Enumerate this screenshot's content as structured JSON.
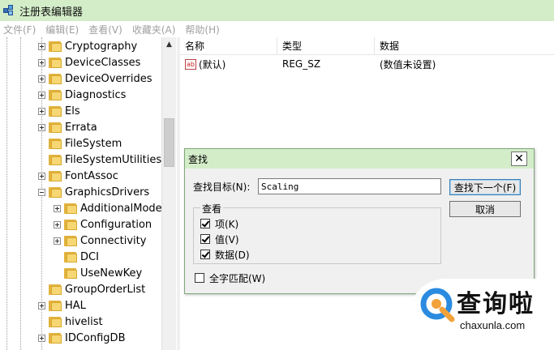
{
  "window": {
    "title": "注册表编辑器"
  },
  "menu": {
    "items": [
      "文件(F)",
      "编辑(E)",
      "查看(V)",
      "收藏夹(A)",
      "帮助(H)"
    ]
  },
  "tree": {
    "items": [
      {
        "label": "Cryptography",
        "expanded": false
      },
      {
        "label": "DeviceClasses",
        "expanded": false
      },
      {
        "label": "DeviceOverrides",
        "expanded": false
      },
      {
        "label": "Diagnostics",
        "expanded": false
      },
      {
        "label": "Els",
        "expanded": false
      },
      {
        "label": "Errata",
        "expanded": false
      },
      {
        "label": "FileSystem",
        "expanded": false
      },
      {
        "label": "FileSystemUtilities",
        "expanded": false
      },
      {
        "label": "FontAssoc",
        "expanded": false
      },
      {
        "label": "GraphicsDrivers",
        "expanded": true
      },
      {
        "label": "AdditionalModel",
        "expanded": false
      },
      {
        "label": "Configuration",
        "expanded": false
      },
      {
        "label": "Connectivity",
        "expanded": false
      },
      {
        "label": "DCI",
        "expanded": false
      },
      {
        "label": "UseNewKey",
        "expanded": false
      },
      {
        "label": "GroupOrderList",
        "expanded": false
      },
      {
        "label": "HAL",
        "expanded": false
      },
      {
        "label": "hivelist",
        "expanded": false
      },
      {
        "label": "IDConfigDB",
        "expanded": false
      }
    ]
  },
  "values": {
    "columns": [
      "名称",
      "类型",
      "数据"
    ],
    "rows": [
      {
        "name": "(默认)",
        "type": "REG_SZ",
        "data": "(数值未设置)",
        "icon": "ab"
      }
    ]
  },
  "find_dialog": {
    "title": "查找",
    "target_label": "查找目标(N):",
    "target_value": "Scaling",
    "find_next_label": "查找下一个(F)",
    "cancel_label": "取消",
    "look_at_label": "查看",
    "checks": [
      {
        "label": "项(K)",
        "checked": true
      },
      {
        "label": "值(V)",
        "checked": true
      },
      {
        "label": "数据(D)",
        "checked": true
      }
    ],
    "match_whole_label": "全字匹配(W)",
    "match_whole_checked": false
  },
  "watermark": {
    "main": "查询啦",
    "sub": "chaxunla.com"
  },
  "colors": {
    "titlebar": "#d4edc9",
    "folder": "#f7d774",
    "accent": "#2b8be0"
  }
}
